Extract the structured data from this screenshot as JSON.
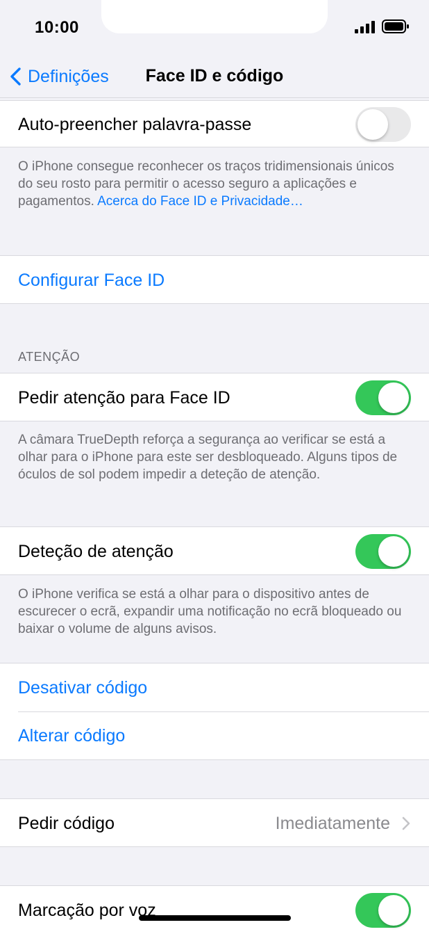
{
  "status_bar": {
    "time": "10:00"
  },
  "nav": {
    "back_label": "Definições",
    "title": "Face ID e código"
  },
  "rows": {
    "autofill": {
      "label": "Auto-preencher palavra-passe",
      "toggle": "off"
    },
    "faceid_footer": {
      "text": "O iPhone consegue reconhecer os traços tridimensionais únicos do seu rosto para permitir o acesso seguro a aplicações e pagamentos. ",
      "link": "Acerca do Face ID e Privacidade…"
    },
    "setup_faceid": {
      "label": "Configurar Face ID"
    },
    "attention_header": "ATENÇÃO",
    "require_attention": {
      "label": "Pedir atenção para Face ID",
      "toggle": "on"
    },
    "require_attention_footer": "A câmara TrueDepth reforça a segurança ao verificar se está a olhar para o iPhone para este ser desbloqueado. Alguns tipos de óculos de sol podem impedir a deteção de atenção.",
    "attention_detection": {
      "label": "Deteção de atenção",
      "toggle": "on"
    },
    "attention_detection_footer": "O iPhone verifica se está a olhar para o dispositivo antes de escurecer o ecrã, expandir uma notificação no ecrã bloqueado ou baixar o volume de alguns avisos.",
    "disable_passcode": {
      "label": "Desativar código"
    },
    "change_passcode": {
      "label": "Alterar código"
    },
    "require_passcode": {
      "label": "Pedir código",
      "value": "Imediatamente"
    },
    "voice_dial": {
      "label": "Marcação por voz",
      "toggle": "on"
    }
  },
  "colors": {
    "accent": "#0a7aff",
    "toggle_on": "#34c759",
    "toggle_off": "#e9e9ea",
    "background": "#f2f2f7"
  },
  "icons": [
    "chevron-left-icon",
    "signal-icon",
    "battery-icon",
    "chevron-right-icon"
  ]
}
